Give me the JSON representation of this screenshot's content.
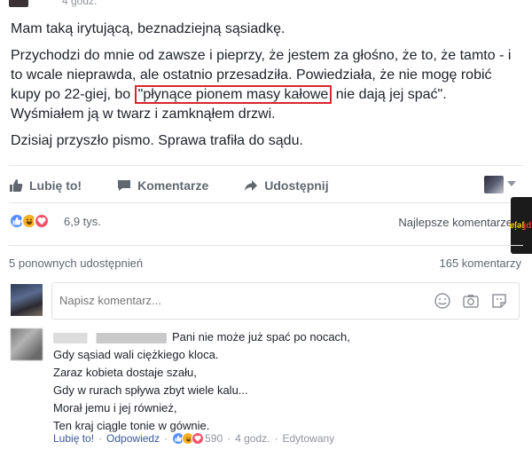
{
  "header": {
    "time": "4 godz."
  },
  "post": {
    "p1": "Mam taką irytującą, beznadziejną sąsiadkę.",
    "p2_before": "Przychodzi do mnie od zawsze i pieprzy, że jestem za głośno, że to, że tamto - i to wcale nieprawda, ale ostatnio przesadziła. Powiedziała, że nie mogę robić kupy po 22-giej, bo ",
    "p2_highlight": "\"płynące pionem masy kałowe",
    "p2_after": " nie dają jej spać\". Wyśmiałem ją w twarz i zamknąłem drzwi.",
    "p3": "Dzisiaj przyszło pismo. Sprawa trafiła do sądu."
  },
  "actions": {
    "like": "Lubię to!",
    "comment": "Komentarze",
    "share": "Udostępnij"
  },
  "reactions": {
    "count": "6,9 tys.",
    "sort": "Najlepsze komentarze"
  },
  "stats": {
    "shares": "5 ponownych udostępnień",
    "comments": "165 komentarzy"
  },
  "composer": {
    "placeholder": "Napisz komentarz..."
  },
  "comment": {
    "lines": [
      "Pani nie może już spać po nocach,",
      "Gdy sąsiad wali ciężkiego kloca.",
      "Zaraz kobieta dostaje szału,",
      "Gdy w rurach spływa zbyt wiele kalu...",
      "Morał jemu i jej również,",
      "Ten kraj ciągle tonie w gównie."
    ],
    "like": "Lubię to!",
    "reply": "Odpowiedz",
    "reaction_count": "590",
    "time": "4 godz.",
    "edited": "Edytowany"
  },
  "watermark": {
    "brand": "jeja",
    "tld": ".pl"
  },
  "colors": {
    "highlight_border": "#d9262c",
    "link": "#385898",
    "like": "#5890ff",
    "haha": "#f7b125",
    "love": "#f25268"
  }
}
